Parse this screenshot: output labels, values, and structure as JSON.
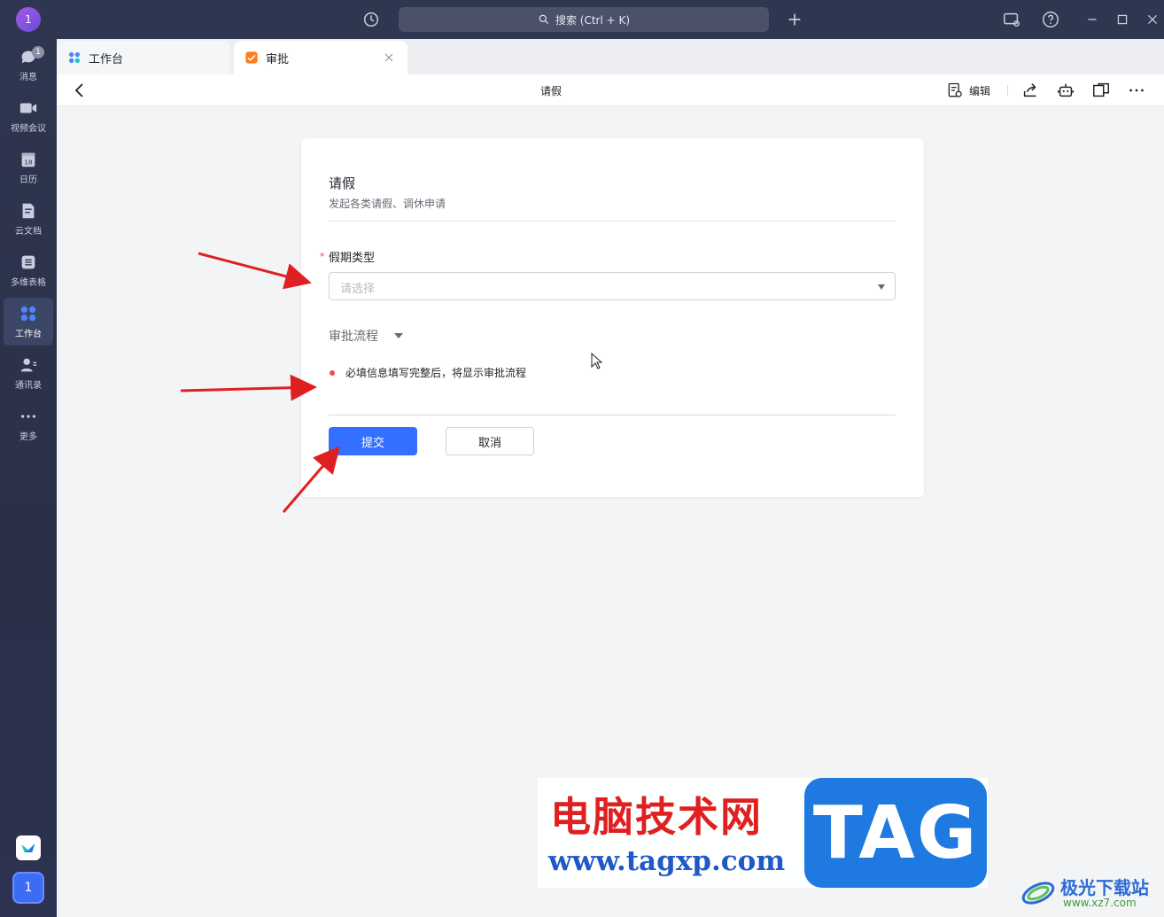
{
  "sidebar": {
    "avatar_text": "1",
    "items": [
      {
        "label": "消息",
        "icon": "chat-bubble-icon",
        "badge": "1"
      },
      {
        "label": "视频会议",
        "icon": "video-camera-icon"
      },
      {
        "label": "日历",
        "icon": "calendar-icon",
        "icon_text": "18"
      },
      {
        "label": "云文档",
        "icon": "document-icon"
      },
      {
        "label": "多维表格",
        "icon": "table-icon"
      },
      {
        "label": "工作台",
        "icon": "workspace-grid-icon",
        "active": true
      },
      {
        "label": "通讯录",
        "icon": "contacts-icon"
      },
      {
        "label": "更多",
        "icon": "more-dots-icon"
      }
    ],
    "bottom_user_text": "1"
  },
  "titlebar": {
    "search_placeholder": "搜索 (Ctrl + K)"
  },
  "tabs": [
    {
      "label": "工作台",
      "icon": "workspace-grid-icon"
    },
    {
      "label": "审批",
      "icon": "approval-app-icon",
      "active": true
    }
  ],
  "pagehead": {
    "title": "请假",
    "edit_label": "编辑"
  },
  "form": {
    "title": "请假",
    "subtitle": "发起各类请假、调休申请",
    "required_mark": "*",
    "field_label": "假期类型",
    "select_placeholder": "请选择",
    "flow_title": "审批流程",
    "flow_hint": "必填信息填写完整后，将显示审批流程",
    "submit_label": "提交",
    "cancel_label": "取消"
  },
  "colors": {
    "primary": "#3370ff",
    "required": "#f54a45",
    "sidebar_bg": "#2f3650",
    "annotation_arrow": "#e02020"
  },
  "watermark": {
    "cn_text": "电脑技术网",
    "tag_text": "TAG",
    "url_text": "www.tagxp.com",
    "corner_cn": "极光下载站",
    "corner_url": "www.xz7.com"
  }
}
